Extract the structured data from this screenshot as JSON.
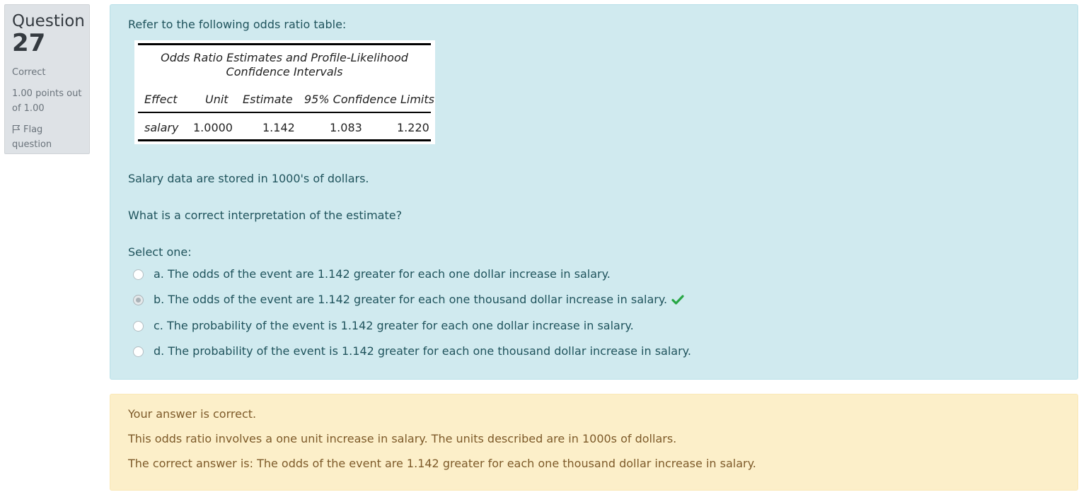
{
  "info": {
    "question_label": "Question",
    "question_number": "27",
    "state": "Correct",
    "grade": "1.00 points out of 1.00",
    "flag_label": "Flag question"
  },
  "question": {
    "prompt": "Refer to the following odds ratio table:",
    "table": {
      "caption_line1": "Odds Ratio Estimates and Profile-Likelihood",
      "caption_line2": "Confidence Intervals",
      "headers": [
        "Effect",
        "Unit",
        "Estimate",
        "95% Confidence Limits"
      ],
      "row": [
        "salary",
        "1.0000",
        "1.142",
        "1.083",
        "1.220"
      ]
    },
    "salary_note": "Salary data are stored in 1000's of dollars.",
    "question_text": "What is a correct interpretation of the estimate?",
    "select_label": "Select one:",
    "options": [
      {
        "label": "a. The odds of the event are 1.142 greater for each one dollar increase in salary.",
        "selected": false
      },
      {
        "label": "b. The odds of the event are 1.142 greater for each one thousand dollar increase in salary.",
        "selected": true,
        "correct_icon": "check-icon"
      },
      {
        "label": "c. The probability of the event is 1.142 greater for each one dollar increase in salary.",
        "selected": false
      },
      {
        "label": "d. The probability of the event is 1.142 greater for each one thousand dollar increase in salary.",
        "selected": false
      }
    ]
  },
  "feedback": {
    "result": "Your answer is correct.",
    "explanation": "This odds ratio involves a one unit increase in salary. The units described are in 1000s of dollars.",
    "right_answer": "The correct answer is: The odds of the event are 1.142 greater for each one thousand dollar increase in salary."
  },
  "colors": {
    "formulation_bg": "#d0eaef",
    "formulation_text": "#1f535c",
    "feedback_bg": "#fcefc9",
    "feedback_text": "#7d5a29",
    "info_bg": "#dee2e6",
    "correct_green": "#28a745"
  }
}
